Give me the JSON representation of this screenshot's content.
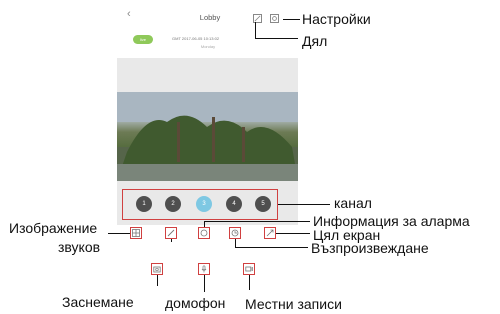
{
  "app": {
    "title": "Lobby",
    "back_icon": "chevron-left-icon",
    "rec_badge": "live",
    "datetime": "GMT 2017-06-05 10:13:02",
    "weekday": "Monday"
  },
  "header_icons": {
    "edit": "edit-icon",
    "settings": "gear-icon"
  },
  "channels": [
    "1",
    "2",
    "3",
    "4",
    "5"
  ],
  "selected_channel": "3",
  "tools": {
    "sound": "grid-icon",
    "image": "edit-icon",
    "alarm_info": "message-icon",
    "playback": "playback-icon",
    "fullscreen": "expand-icon",
    "snapshot": "camera-icon",
    "intercom": "microphone-icon",
    "record": "video-record-icon"
  },
  "labels": {
    "settings": "Настройки",
    "share": "Дял",
    "channel": "канал",
    "alarm_info": "Информация за аларма",
    "fullscreen": "Цял екран",
    "playback": "Възпроизвеждане",
    "image": "Изображение",
    "sound": "звуков",
    "snapshot": "Заснемане",
    "intercom": "домофон",
    "local_records": "Местни записи"
  },
  "colors": {
    "callout_border": "#d04040",
    "selected_channel": "#7ec8e3",
    "channel": "#4f4f4f",
    "rec_badge": "#8fc95a"
  }
}
